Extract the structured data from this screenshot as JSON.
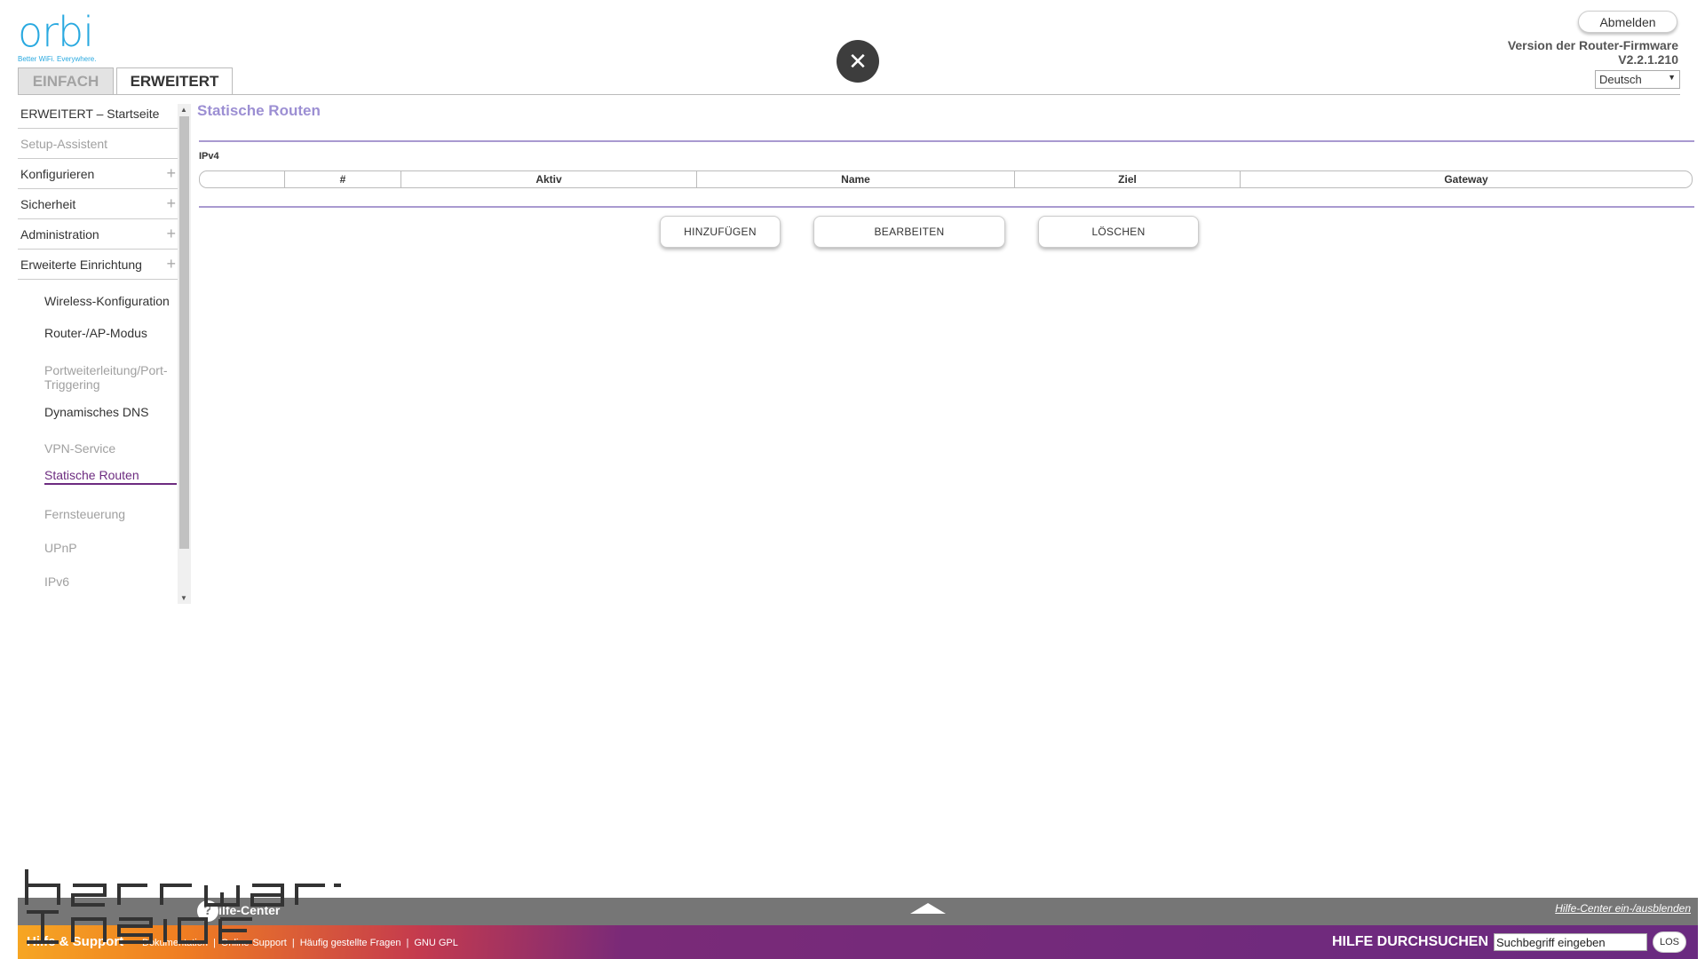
{
  "brand": {
    "logo": "orbi",
    "tagline": "Better WiFi. Everywhere."
  },
  "tabs": [
    {
      "label": "EINFACH",
      "active": false
    },
    {
      "label": "ERWEITERT",
      "active": true
    }
  ],
  "header": {
    "logout": "Abmelden",
    "firmware_label": "Version der Router-Firmware",
    "firmware_version": "V2.2.1.210",
    "language": "Deutsch",
    "close_symbol": "✕"
  },
  "sidebar": {
    "main_items": [
      {
        "label": "ERWEITERT – Startseite"
      },
      {
        "label": "Setup-Assistent"
      },
      {
        "label": "Konfigurieren"
      },
      {
        "label": "Sicherheit"
      },
      {
        "label": "Administration"
      },
      {
        "label": "Erweiterte Einrichtung"
      }
    ],
    "sub_items": [
      {
        "label": "Wireless-Konfiguration"
      },
      {
        "label": "Router-/AP-Modus"
      },
      {
        "label": "Portweiterleitung/Port-Triggering"
      },
      {
        "label": "Dynamisches DNS"
      },
      {
        "label": "VPN-Service"
      },
      {
        "label": "Statische Routen"
      },
      {
        "label": "Fernsteuerung"
      },
      {
        "label": "UPnP"
      },
      {
        "label": "IPv6"
      }
    ]
  },
  "main": {
    "title": "Statische Routen",
    "section": "IPv4",
    "columns": [
      "",
      "#",
      "Aktiv",
      "Name",
      "Ziel",
      "Gateway"
    ],
    "buttons": {
      "add": "HINZUFÜGEN",
      "edit": "BEARBEITEN",
      "delete": "LÖSCHEN"
    }
  },
  "help": {
    "title": "Hilfe-Center",
    "toggle": "Hilfe-Center ein-/ausblenden",
    "support_title": "Hilfe & Support",
    "links": [
      "Dokumentation",
      "Online-Support",
      "Häufig gestellte Fragen",
      "GNU GPL"
    ],
    "search_label": "HILFE DURCHSUCHEN",
    "search_value": "Suchbegriff eingeben",
    "search_button": "LOS"
  },
  "colors": {
    "accent_purple": "#6d2c80",
    "title_lavender": "#9c8fd3",
    "logo_blue": "#29a9e0",
    "help_gray": "#767676"
  }
}
